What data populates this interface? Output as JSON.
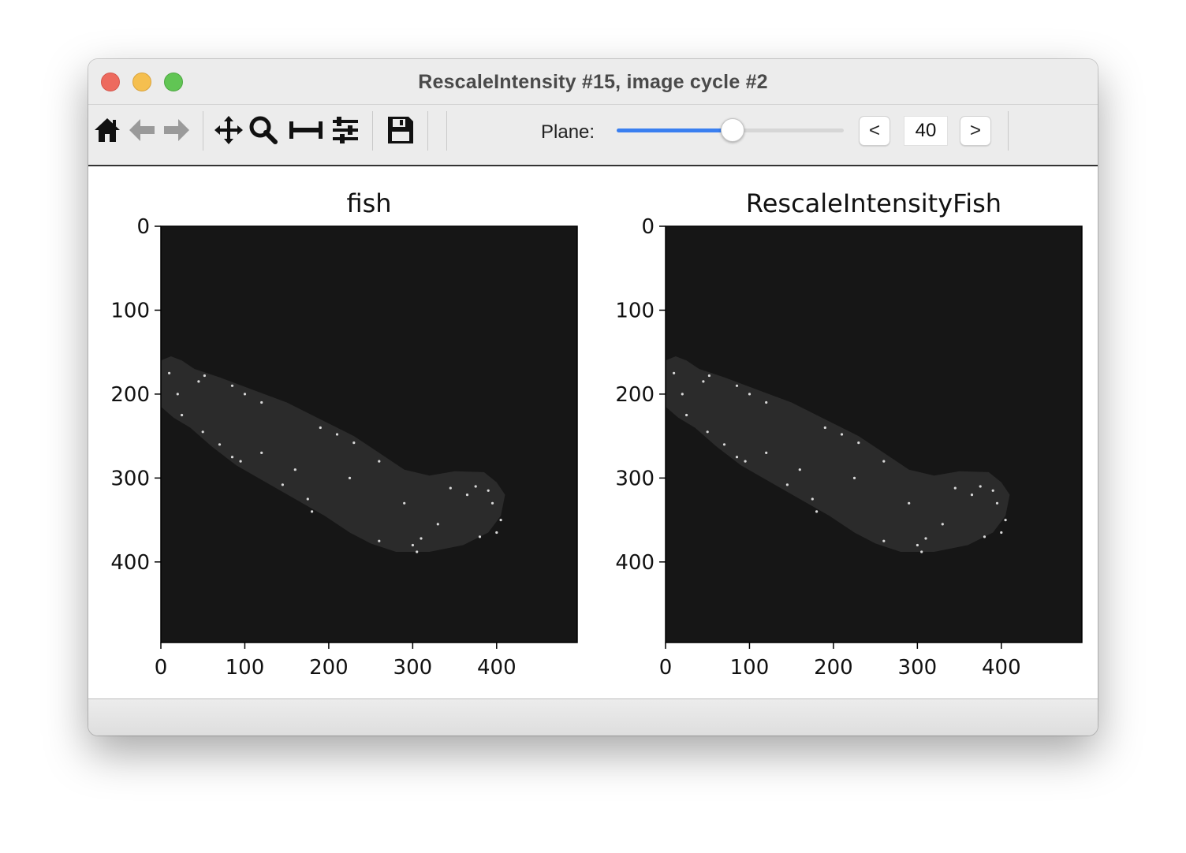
{
  "window": {
    "title": "RescaleIntensity #15, image cycle #2"
  },
  "toolbar": {
    "icons": [
      "home-icon",
      "back-arrow-icon",
      "forward-arrow-icon",
      "pan-icon",
      "zoom-icon",
      "subplots-icon",
      "configure-icon",
      "save-icon"
    ],
    "plane_label": "Plane:",
    "plane_value": "40",
    "plane_slider_fraction": 0.51,
    "prev_label": "<",
    "next_label": ">"
  },
  "colors": {
    "slider_accent": "#3a7ff0",
    "image_background": "#161616",
    "fish_fill": "#2b2b2b",
    "spot": "#d9d9d9"
  },
  "plots": [
    {
      "title": "fish",
      "xticks": [
        "0",
        "100",
        "200",
        "300",
        "400"
      ],
      "yticks": [
        "0",
        "100",
        "200",
        "300",
        "400"
      ]
    },
    {
      "title": "RescaleIntensityFish",
      "xticks": [
        "0",
        "100",
        "200",
        "300",
        "400"
      ],
      "yticks": [
        "0",
        "100",
        "200",
        "300",
        "400"
      ]
    }
  ]
}
